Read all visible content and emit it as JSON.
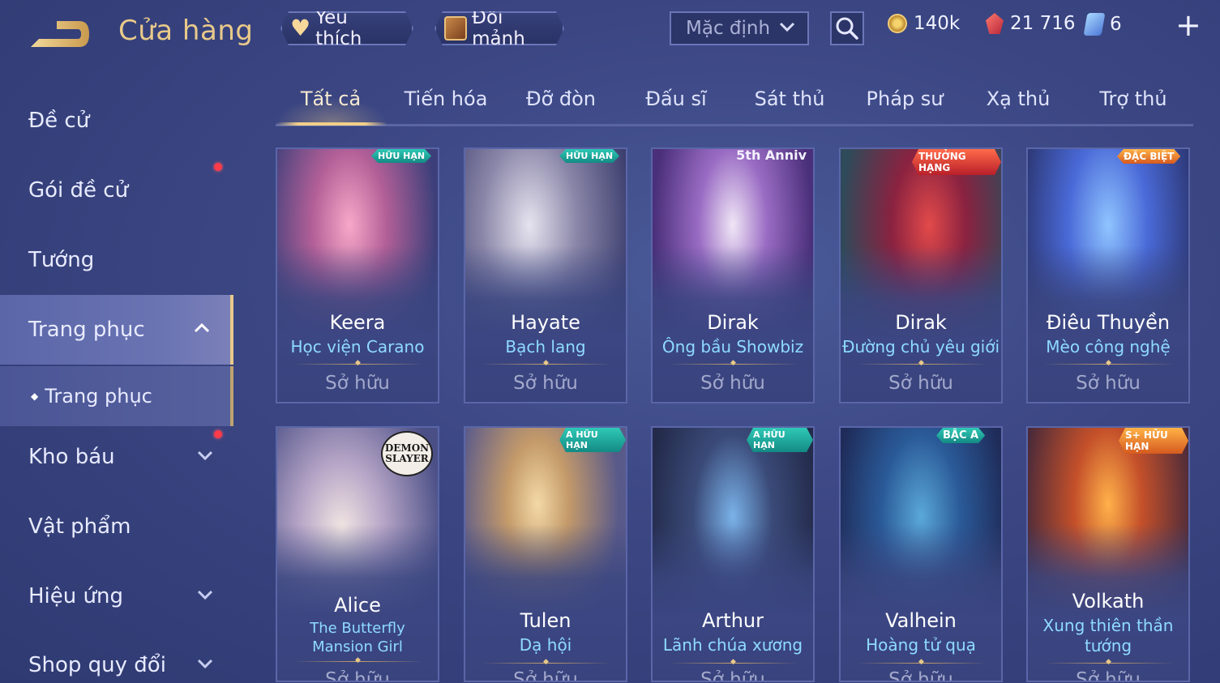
{
  "header": {
    "title": "Cửa hàng",
    "favorite_label": "Yêu thích",
    "exchange_label": "Đổi mảnh",
    "sort_value": "Mặc định",
    "currencies": {
      "gold": "140k",
      "ruby": "21 716",
      "voucher": "6"
    }
  },
  "sidebar": {
    "items": [
      {
        "label": "Đề cử"
      },
      {
        "label": "Gói đề cử"
      },
      {
        "label": "Tướng"
      },
      {
        "label": "Trang phục"
      },
      {
        "label": "Trang phục"
      },
      {
        "label": "Kho báu"
      },
      {
        "label": "Vật phẩm"
      },
      {
        "label": "Hiệu ứng"
      },
      {
        "label": "Shop quy đổi"
      }
    ]
  },
  "tabs": [
    "Tất cả",
    "Tiến hóa",
    "Đỡ đòn",
    "Đấu sĩ",
    "Sát thủ",
    "Pháp sư",
    "Xạ thủ",
    "Trợ thủ"
  ],
  "cards": [
    {
      "hero": "Keera",
      "skin": "Học viện Carano",
      "status": "Sở hữu",
      "badge": "HỮU HẠN"
    },
    {
      "hero": "Hayate",
      "skin": "Bạch lang",
      "status": "Sở hữu",
      "badge": "HỮU HẠN"
    },
    {
      "hero": "Dirak",
      "skin": "Ông bầu Showbiz",
      "status": "Sở hữu",
      "badge": "5th Anniv"
    },
    {
      "hero": "Dirak",
      "skin": "Đường chủ yêu giới",
      "status": "Sở hữu",
      "badge": "THƯỞNG HẠNG"
    },
    {
      "hero": "Điêu Thuyền",
      "skin": "Mèo công nghệ",
      "status": "Sở hữu",
      "badge": "ĐẶC BIỆT"
    },
    {
      "hero": "Alice",
      "skin": "The Butterfly Mansion Girl",
      "status": "Sở hữu",
      "badge": "DEMON SLAYER"
    },
    {
      "hero": "Tulen",
      "skin": "Dạ hội",
      "status": "Sở hữu",
      "badge": "A HỮU HẠN"
    },
    {
      "hero": "Arthur",
      "skin": "Lãnh chúa xương",
      "status": "Sở hữu",
      "badge": "A HỮU HẠN"
    },
    {
      "hero": "Valhein",
      "skin": "Hoàng tử quạ",
      "status": "Sở hữu",
      "badge": "BẬC A"
    },
    {
      "hero": "Volkath",
      "skin": "Xung thiên thần tướng",
      "status": "Sở hữu",
      "badge": "S+ HỮU HẠN"
    }
  ],
  "colors": {
    "accent_gold": "#e9c98a",
    "skin_name": "#8fdbff",
    "notification": "#ff3b4a"
  }
}
